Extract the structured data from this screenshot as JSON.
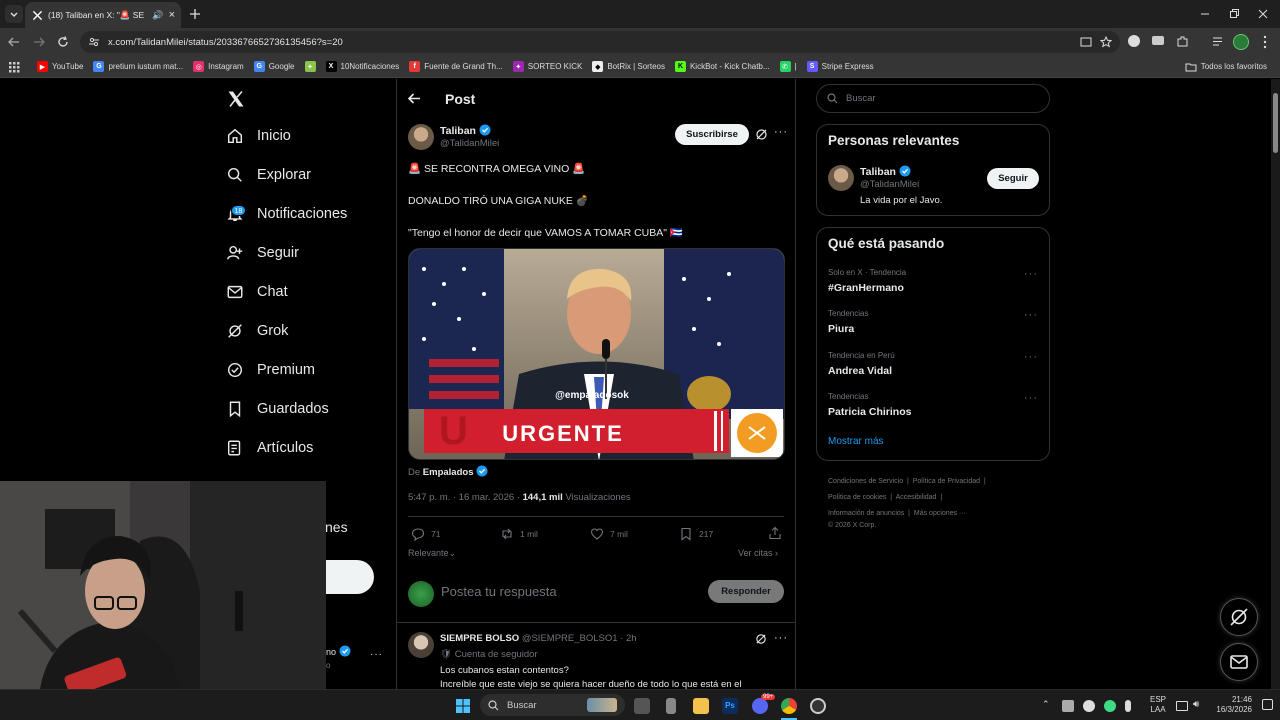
{
  "browser": {
    "tab_title": "(18) Taliban en X: \"🚨 SE RECONTRA OMEGA VINO 🚨",
    "url": "x.com/TalidanMilei/status/2033676652736135456?s=20",
    "bookmarks": [
      {
        "label": "YouTube",
        "color": "#ff0000",
        "glyph": "▶"
      },
      {
        "label": "pretium iustum mat...",
        "color": "#4285f4",
        "glyph": "G"
      },
      {
        "label": "Instagram",
        "color": "#e1306c",
        "glyph": "◎"
      },
      {
        "label": "Google",
        "color": "#4285f4",
        "glyph": "G"
      },
      {
        "label": "",
        "color": "#8bc34a",
        "glyph": "✦"
      },
      {
        "label": "10Notificaciones",
        "color": "#000000",
        "glyph": "X"
      },
      {
        "label": "Fuente de Grand Th...",
        "color": "#e53935",
        "glyph": "f"
      },
      {
        "label": "SORTEO KICK",
        "color": "#9c27b0",
        "glyph": "✦"
      },
      {
        "label": "BotRix | Sorteos",
        "color": "#eeeeee",
        "glyph": "◆"
      },
      {
        "label": "KickBot - Kick Chatb...",
        "color": "#53fc18",
        "glyph": "K"
      },
      {
        "label": "|",
        "color": "#25d366",
        "glyph": "✆"
      },
      {
        "label": "Stripe Express",
        "color": "#635bff",
        "glyph": "S"
      }
    ],
    "all_bookmarks": "Todos los favoritos"
  },
  "sidebar": {
    "notif_badge": "18",
    "items": [
      {
        "label": "Inicio",
        "icon": "home-icon"
      },
      {
        "label": "Explorar",
        "icon": "search-icon"
      },
      {
        "label": "Notificaciones",
        "icon": "bell-icon"
      },
      {
        "label": "Seguir",
        "icon": "person-add-icon"
      },
      {
        "label": "Chat",
        "icon": "mail-icon"
      },
      {
        "label": "Grok",
        "icon": "grok-icon"
      },
      {
        "label": "Premium",
        "icon": "premium-icon"
      },
      {
        "label": "Guardados",
        "icon": "bookmark-icon"
      },
      {
        "label": "Artículos",
        "icon": "articles-icon"
      }
    ],
    "partial_more": "nes",
    "partial_user": "no"
  },
  "post": {
    "header": "Post",
    "author_name": "Taliban",
    "author_handle": "@TalidanMilei",
    "subscribe": "Suscribirse",
    "line1": "🚨 SE RECONTRA OMEGA VINO 🚨",
    "line2": "DONALDO TIRÓ UNA GIGA NUKE 💣",
    "line3": "\"Tengo el honor de decir que VAMOS A TOMAR CUBA\" 🇨🇺",
    "media_watermark": "@empaladosok",
    "media_banner": "URGENTE",
    "from_prefix": "De",
    "from_name": "Empalados",
    "time": "5:47 p. m. · 16 mar. 2026 ·",
    "views_count": "144,1 mil",
    "views_label": "Visualizaciones",
    "replies": "71",
    "reposts": "1 mil",
    "likes": "7 mil",
    "bookmarks": "217",
    "sort": "Relevante",
    "quotes": "Ver citas",
    "reply_placeholder": "Postea tu respuesta",
    "reply_button": "Responder"
  },
  "reply": {
    "name": "SIEMPRE BOLSO",
    "handle": "@SIEMPRE_BOLSO1 · 2h",
    "badge": "Cuenta de seguidor",
    "text1": "Los cubanos estan contentos?",
    "text2": "Increíble que este viejo se quiera hacer dueño de todo lo que está en el"
  },
  "right": {
    "search_placeholder": "Buscar",
    "relevant_title": "Personas relevantes",
    "person_name": "Taliban",
    "person_handle": "@TalidanMilei",
    "person_bio": "La vida por el Javo.",
    "follow": "Seguir",
    "happening_title": "Qué está pasando",
    "trends": [
      {
        "cat": "Solo en X · Tendencia",
        "name": "#GranHermano"
      },
      {
        "cat": "Tendencias",
        "name": "Piura"
      },
      {
        "cat": "Tendencia en Perú",
        "name": "Andrea Vidal"
      },
      {
        "cat": "Tendencias",
        "name": "Patricia Chirinos"
      }
    ],
    "show_more": "Mostrar más",
    "footer": {
      "terms": "Condiciones de Servicio",
      "privacy": "Política de Privacidad",
      "cookies": "Política de cookies",
      "access": "Accesibilidad",
      "ads": "Información de anuncios",
      "more": "Más opciones ···",
      "copy": "© 2026 X Corp."
    }
  },
  "taskbar": {
    "search": "Buscar",
    "lang1": "ESP",
    "lang2": "LAA",
    "time": "21:46",
    "date": "16/3/2026",
    "discord_badge": "99+"
  }
}
